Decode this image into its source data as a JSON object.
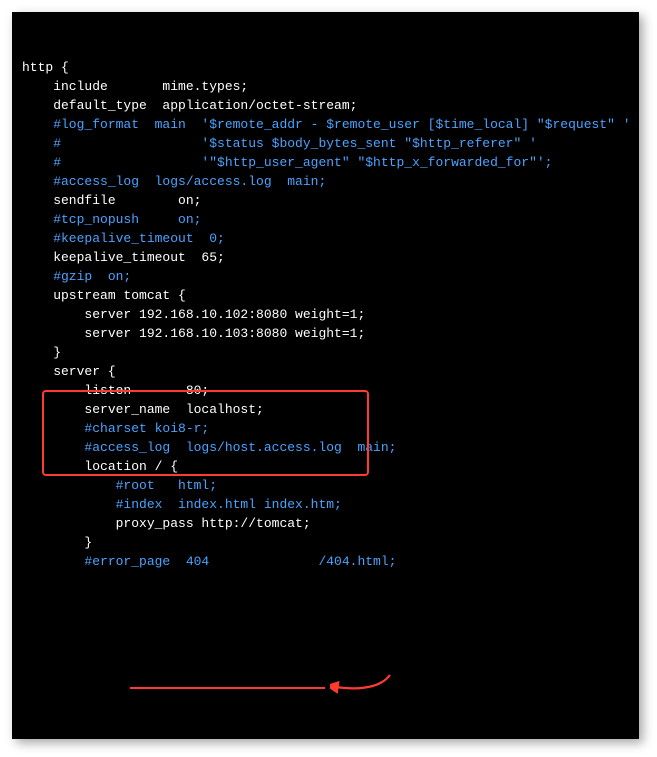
{
  "lines": [
    {
      "t": "http {",
      "c": "plain"
    },
    {
      "t": "    include       mime.types;",
      "c": "plain"
    },
    {
      "t": "    default_type  application/octet-stream;",
      "c": "plain"
    },
    {
      "t": "",
      "c": "plain"
    },
    {
      "t": "    #log_format  main  '$remote_addr - $remote_user [$time_local] \"$request\" '",
      "c": "comment"
    },
    {
      "t": "    #                  '$status $body_bytes_sent \"$http_referer\" '",
      "c": "comment"
    },
    {
      "t": "    #                  '\"$http_user_agent\" \"$http_x_forwarded_for\"';",
      "c": "comment"
    },
    {
      "t": "",
      "c": "plain"
    },
    {
      "t": "    #access_log  logs/access.log  main;",
      "c": "comment"
    },
    {
      "t": "",
      "c": "plain"
    },
    {
      "t": "    sendfile        on;",
      "c": "plain"
    },
    {
      "t": "    #tcp_nopush     on;",
      "c": "comment"
    },
    {
      "t": "",
      "c": "plain"
    },
    {
      "t": "    #keepalive_timeout  0;",
      "c": "comment"
    },
    {
      "t": "    keepalive_timeout  65;",
      "c": "plain"
    },
    {
      "t": "",
      "c": "plain"
    },
    {
      "t": "    #gzip  on;",
      "c": "comment"
    },
    {
      "t": "",
      "c": "plain"
    },
    {
      "t": "",
      "c": "plain"
    },
    {
      "t": "    upstream tomcat {",
      "c": "plain"
    },
    {
      "t": "        server 192.168.10.102:8080 weight=1;",
      "c": "plain"
    },
    {
      "t": "        server 192.168.10.103:8080 weight=1;",
      "c": "plain"
    },
    {
      "t": "    }",
      "c": "plain"
    },
    {
      "t": "",
      "c": "plain"
    },
    {
      "t": "    server {",
      "c": "plain"
    },
    {
      "t": "        listen       80;",
      "c": "plain"
    },
    {
      "t": "        server_name  localhost;",
      "c": "plain"
    },
    {
      "t": "",
      "c": "plain"
    },
    {
      "t": "        #charset koi8-r;",
      "c": "comment"
    },
    {
      "t": "",
      "c": "plain"
    },
    {
      "t": "        #access_log  logs/host.access.log  main;",
      "c": "comment"
    },
    {
      "t": "",
      "c": "plain"
    },
    {
      "t": "        location / {",
      "c": "plain"
    },
    {
      "t": "            #root   html;",
      "c": "comment"
    },
    {
      "t": "            #index  index.html index.htm;",
      "c": "comment"
    },
    {
      "t": "            proxy_pass http://tomcat;",
      "c": "plain"
    },
    {
      "t": "        }",
      "c": "plain"
    },
    {
      "t": "",
      "c": "plain"
    },
    {
      "t": "        #error_page  404              /404.html;",
      "c": "comment"
    }
  ]
}
